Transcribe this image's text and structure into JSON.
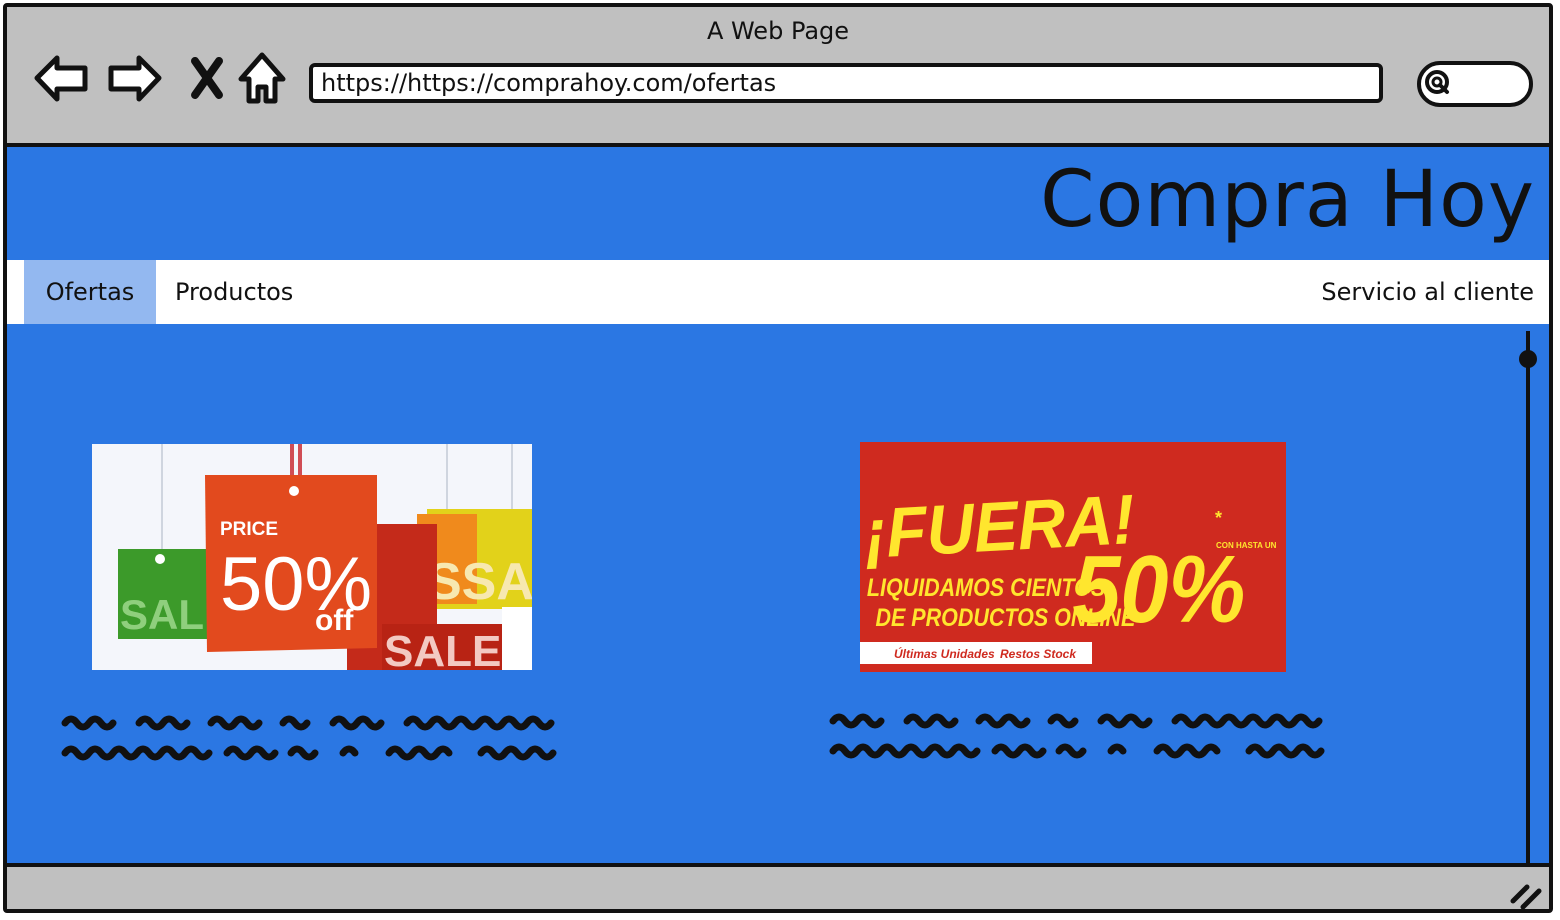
{
  "window": {
    "title": "A Web Page"
  },
  "toolbar": {
    "back_icon": "back-arrow-icon",
    "forward_icon": "forward-arrow-icon",
    "stop_icon": "close-x-icon",
    "home_icon": "home-icon",
    "url": "https://https://comprahoy.com/ofertas",
    "search_icon": "search-icon"
  },
  "site": {
    "brand": "Compra Hoy"
  },
  "menu": {
    "items": [
      {
        "label": "Ofertas",
        "active": true
      },
      {
        "label": "Productos",
        "active": false
      },
      {
        "label": "Servicio al cliente",
        "active": false
      }
    ]
  },
  "offers": [
    {
      "image": {
        "price_label": "PRICE",
        "percent": "50%",
        "off": "off",
        "sale_word": "SALE",
        "sale_partial_left": "SAL",
        "sale_partial_right": "SSAL"
      }
    },
    {
      "image": {
        "headline": "¡FUERA!",
        "line1": "LIQUIDAMOS CIENTOS",
        "line2": "DE PRODUCTOS ONLINE",
        "small_top": "CON HASTA UN",
        "percent": "50%",
        "asterisk": "*",
        "tag1": "Últimas Unidades",
        "tag2": "Restos Stock"
      }
    }
  ],
  "colors": {
    "page_bg": "#2b77e3",
    "chrome": "#c0c0c0",
    "menu_active": "#93b8f0",
    "banner_red": "#cf2a1f",
    "banner_yellow": "#ffe62e"
  }
}
